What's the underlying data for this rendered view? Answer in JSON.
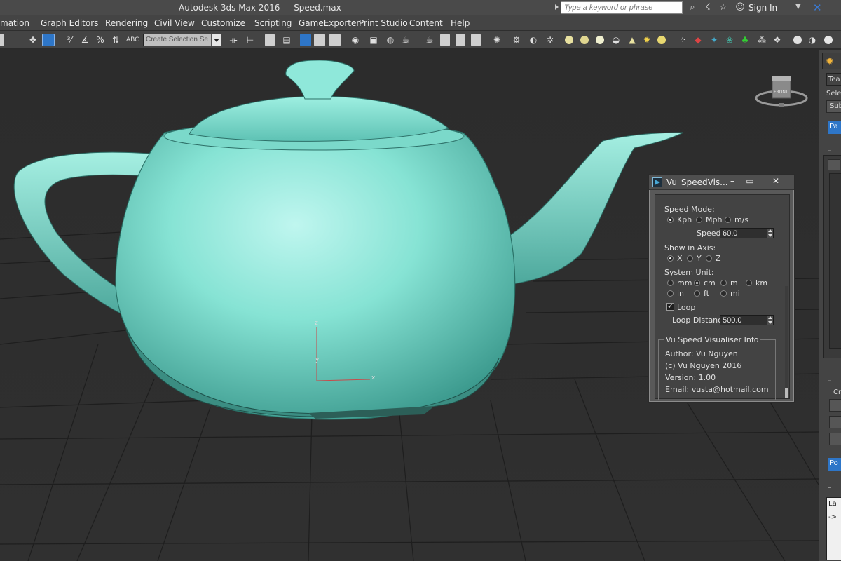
{
  "window": {
    "app_title": "Autodesk 3ds Max 2016",
    "file_name": "Speed.max",
    "search_placeholder": "Type a keyword or phrase",
    "sign_in": "Sign In"
  },
  "menu": {
    "items": [
      "mation",
      "Graph Editors",
      "Rendering",
      "Civil View",
      "Customize",
      "Scripting",
      "GameExporter",
      "Print Studio",
      "Content",
      "Help"
    ]
  },
  "toolbar": {
    "selection_set_placeholder": "Create Selection Se"
  },
  "viewport": {
    "axis_z": "z",
    "axis_y": "y",
    "axis_x": "x",
    "viewcube_face": "FRONT",
    "object_color": "#7fe0d0"
  },
  "command_panel": {
    "t1": "Tea",
    "t2": "Selec",
    "t3": "Sub",
    "b1": "Pa",
    "t4": "Cr",
    "b2": "Po",
    "t5": "La",
    "t6": "->"
  },
  "dialog": {
    "title": "Vu_SpeedVis...",
    "speed_mode_label": "Speed Mode:",
    "mode_kph": "Kph",
    "mode_mph": "Mph",
    "mode_ms": "m/s",
    "speed_label": "Speed",
    "speed_value": "60.0",
    "axis_label": "Show in Axis:",
    "axis_x": "X",
    "axis_y": "Y",
    "axis_z": "Z",
    "unit_label": "System Unit:",
    "unit_mm": "mm",
    "unit_cm": "cm",
    "unit_m": "m",
    "unit_km": "km",
    "unit_in": "in",
    "unit_ft": "ft",
    "unit_mi": "mi",
    "loop_label": "Loop",
    "loop_distance_label": "Loop Distance",
    "loop_distance_value": "500.0",
    "info_title": "Vu Speed Visualiser Info",
    "author": "Author: Vu Nguyen",
    "copyright": "(c) Vu Nguyen 2016",
    "version": "Version: 1.00",
    "email": "Email: vusta@hotmail.com"
  }
}
